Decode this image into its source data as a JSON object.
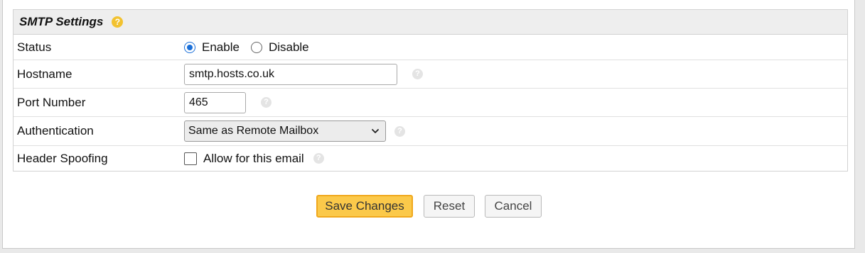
{
  "section": {
    "title": "SMTP Settings",
    "help_glyph": "?"
  },
  "rows": {
    "status": {
      "label": "Status",
      "options": [
        "Enable",
        "Disable"
      ],
      "selected": "Enable"
    },
    "hostname": {
      "label": "Hostname",
      "value": "smtp.hosts.co.uk",
      "help_glyph": "?"
    },
    "port": {
      "label": "Port Number",
      "value": "465",
      "help_glyph": "?"
    },
    "authentication": {
      "label": "Authentication",
      "selected": "Same as Remote Mailbox",
      "help_glyph": "?"
    },
    "header_spoofing": {
      "label": "Header Spoofing",
      "checkbox_label": "Allow for this email",
      "checked": false,
      "help_glyph": "?"
    }
  },
  "actions": {
    "save": "Save Changes",
    "reset": "Reset",
    "cancel": "Cancel"
  },
  "icons": {
    "section_help": "question-circle-icon",
    "field_help": "question-circle-icon",
    "dropdown": "chevron-down-icon"
  },
  "colors": {
    "accent_blue": "#1a6fd8",
    "primary_button": "#fbc94a",
    "primary_button_border": "#f0a81c",
    "help_yellow": "#f2c230",
    "help_gray": "#e4e4e4",
    "header_bg": "#eeeeee"
  }
}
